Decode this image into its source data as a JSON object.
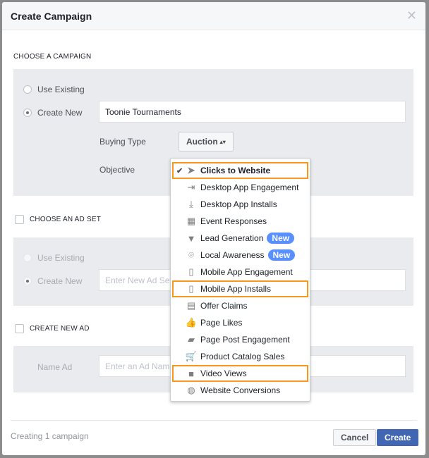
{
  "dialog": {
    "title": "Create Campaign",
    "close_icon": "close-icon"
  },
  "campaign": {
    "section_label": "CHOOSE A CAMPAIGN",
    "use_existing": "Use Existing",
    "create_new": "Create New",
    "name_value": "Toonie Tournaments",
    "buying_type_label": "Buying Type",
    "buying_type_value": "Auction",
    "objective_label": "Objective"
  },
  "adset": {
    "section_label": "CHOOSE AN AD SET",
    "use_existing": "Use Existing",
    "create_new": "Create New",
    "name_placeholder": "Enter New Ad Set Name"
  },
  "ad": {
    "section_label": "CREATE NEW AD",
    "name_label": "Name Ad",
    "name_placeholder": "Enter an Ad Name"
  },
  "objective_menu": {
    "items": [
      {
        "label": "Clicks to Website",
        "icon": "cursor-icon",
        "selected": true,
        "highlighted": true
      },
      {
        "label": "Desktop App Engagement",
        "icon": "desktop-engagement-icon"
      },
      {
        "label": "Desktop App Installs",
        "icon": "desktop-install-icon"
      },
      {
        "label": "Event Responses",
        "icon": "calendar-icon"
      },
      {
        "label": "Lead Generation",
        "icon": "funnel-icon",
        "badge": "New"
      },
      {
        "label": "Local Awareness",
        "icon": "map-pin-icon",
        "badge": "New"
      },
      {
        "label": "Mobile App Engagement",
        "icon": "mobile-engagement-icon"
      },
      {
        "label": "Mobile App Installs",
        "icon": "mobile-install-icon",
        "highlighted": true
      },
      {
        "label": "Offer Claims",
        "icon": "store-icon"
      },
      {
        "label": "Page Likes",
        "icon": "thumbs-up-icon"
      },
      {
        "label": "Page Post Engagement",
        "icon": "comments-icon"
      },
      {
        "label": "Product Catalog Sales",
        "icon": "cart-icon"
      },
      {
        "label": "Video Views",
        "icon": "video-camera-icon",
        "highlighted": true
      },
      {
        "label": "Website Conversions",
        "icon": "globe-icon"
      }
    ],
    "highlight_color": "#f7981d",
    "badge_color": "#5890ff"
  },
  "footer": {
    "status": "Creating 1 campaign",
    "cancel": "Cancel",
    "create": "Create"
  }
}
